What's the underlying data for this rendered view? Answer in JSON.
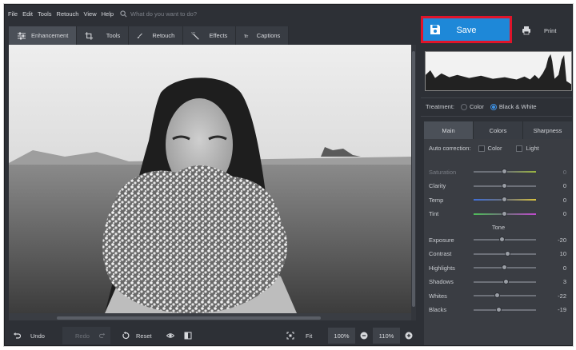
{
  "menu": {
    "items": [
      "File",
      "Edit",
      "Tools",
      "Retouch",
      "View",
      "Help"
    ],
    "search_placeholder": "What do you want to do?"
  },
  "tabs": [
    {
      "label": "Enhancement",
      "icon": "sliders-icon"
    },
    {
      "label": "Tools",
      "icon": "crop-icon"
    },
    {
      "label": "Retouch",
      "icon": "brush-icon"
    },
    {
      "label": "Effects",
      "icon": "magic-wand-icon"
    },
    {
      "label": "Captions",
      "icon": "text-icon"
    }
  ],
  "actions": {
    "save_label": "Save",
    "print_label": "Print"
  },
  "treatment": {
    "label": "Treatment:",
    "options": [
      "Color",
      "Black & White"
    ],
    "selected": "Black & White"
  },
  "subtabs": [
    "Main",
    "Colors",
    "Sharpness"
  ],
  "auto_correction": {
    "label": "Auto correction:",
    "options": [
      "Color",
      "Light"
    ]
  },
  "tone_header": "Tone",
  "adjustments": [
    {
      "label": "Saturation",
      "value": "0",
      "level": 0.5,
      "enabled": false
    },
    {
      "label": "Clarity",
      "value": "0",
      "level": 0.5,
      "enabled": true
    },
    {
      "label": "Temp",
      "value": "0",
      "level": 0.5,
      "enabled": true
    },
    {
      "label": "Tint",
      "value": "0",
      "level": 0.5,
      "enabled": true
    }
  ],
  "tone": [
    {
      "label": "Exposure",
      "value": "-20",
      "level": 0.46,
      "enabled": true
    },
    {
      "label": "Contrast",
      "value": "10",
      "level": 0.55,
      "enabled": true
    },
    {
      "label": "Highlights",
      "value": "0",
      "level": 0.5,
      "enabled": true
    },
    {
      "label": "Shadows",
      "value": "3",
      "level": 0.52,
      "enabled": true
    },
    {
      "label": "Whites",
      "value": "-22",
      "level": 0.39,
      "enabled": true
    },
    {
      "label": "Blacks",
      "value": "-19",
      "level": 0.41,
      "enabled": true
    }
  ],
  "bottom": {
    "undo_label": "Undo",
    "redo_label": "Redo",
    "reset_label": "Reset",
    "fit_label": "Fit",
    "zoom_100": "100%",
    "zoom_current": "110%"
  },
  "colors": {
    "accent": "#1e88d8",
    "highlight_border": "#e0142a",
    "panel_bg": "#2d3036"
  }
}
